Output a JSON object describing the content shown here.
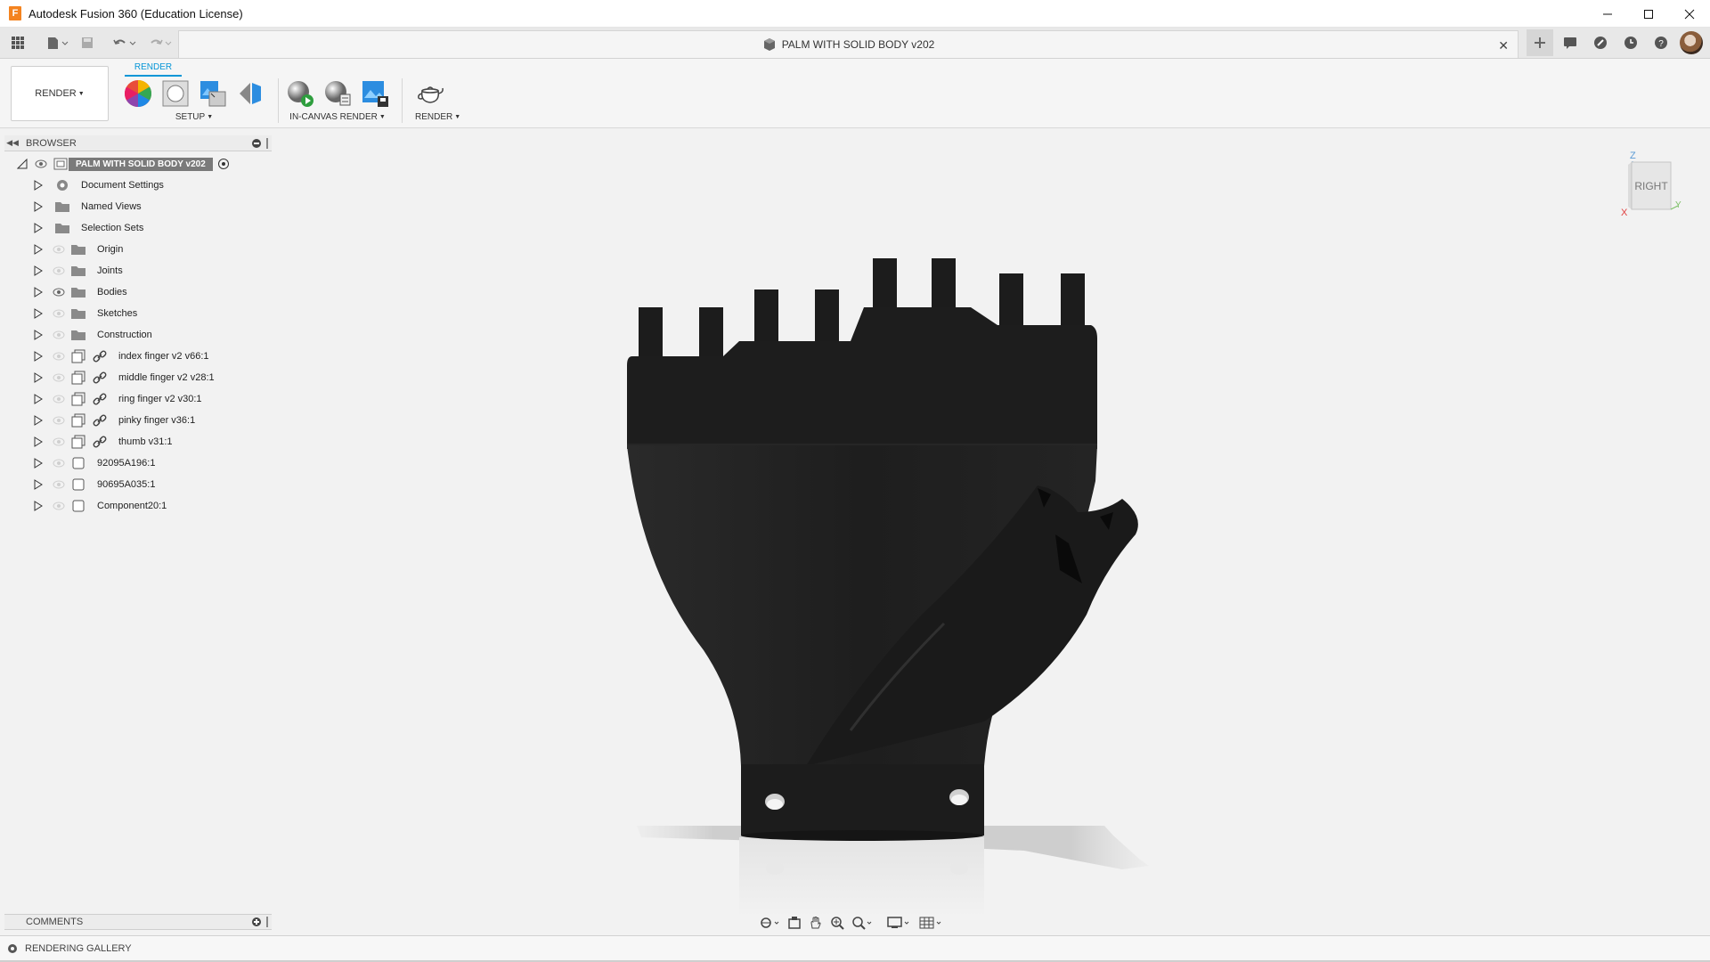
{
  "window": {
    "title": "Autodesk Fusion 360 (Education License)"
  },
  "document_tab": {
    "title": "PALM WITH SOLID BODY v202"
  },
  "ribbon": {
    "workspace": "RENDER",
    "active_tab": "RENDER",
    "groups": {
      "setup": "SETUP",
      "in_canvas": "IN-CANVAS RENDER",
      "render": "RENDER"
    }
  },
  "browser": {
    "title": "BROWSER",
    "root": "PALM WITH SOLID BODY v202",
    "items": [
      {
        "label": "Document Settings",
        "icon": "gear-icon"
      },
      {
        "label": "Named Views",
        "icon": "folder-icon"
      },
      {
        "label": "Selection Sets",
        "icon": "folder-icon"
      },
      {
        "label": "Origin",
        "icon": "folder-icon"
      },
      {
        "label": "Joints",
        "icon": "folder-icon"
      },
      {
        "label": "Bodies",
        "icon": "folder-icon"
      },
      {
        "label": "Sketches",
        "icon": "folder-icon"
      },
      {
        "label": "Construction",
        "icon": "folder-icon"
      },
      {
        "label": "index finger v2 v66:1",
        "icon": "linked-component-icon"
      },
      {
        "label": "middle finger v2 v28:1",
        "icon": "linked-component-icon"
      },
      {
        "label": "ring finger v2 v30:1",
        "icon": "linked-component-icon"
      },
      {
        "label": "pinky finger v36:1",
        "icon": "linked-component-icon"
      },
      {
        "label": "thumb v31:1",
        "icon": "linked-component-icon"
      },
      {
        "label": "92095A196:1",
        "icon": "component-icon"
      },
      {
        "label": "90695A035:1",
        "icon": "component-icon"
      },
      {
        "label": "Component20:1",
        "icon": "component-icon"
      }
    ]
  },
  "viewcube": {
    "face": "RIGHT",
    "axis_z": "Z",
    "axis_y": "Y",
    "axis_x": "X"
  },
  "comments": {
    "label": "COMMENTS"
  },
  "gallery": {
    "label": "RENDERING GALLERY"
  },
  "colors": {
    "accent": "#0696d7",
    "model": "#1e1e1e",
    "canvas": "#f2f2f2"
  }
}
